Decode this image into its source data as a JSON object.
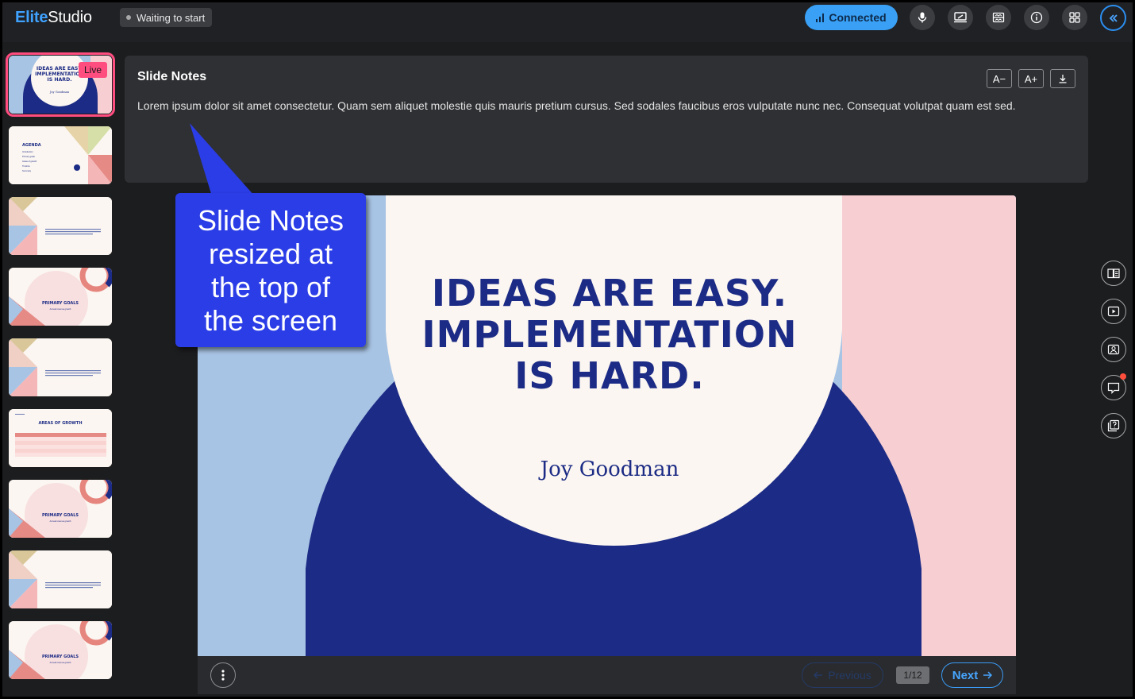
{
  "app": {
    "logo_brand": "Elite",
    "logo_rest": "Studio",
    "status": "Waiting to start",
    "connected_label": "Connected"
  },
  "top_icons": [
    "microphone-icon",
    "screen-share-icon",
    "layout-icon",
    "info-icon",
    "apps-grid-icon"
  ],
  "slides": {
    "live_label": "Live",
    "thumbnails": [
      {
        "title": "IDEAS ARE EASY. IMPLEMENTATION IS HARD.",
        "subtitle": "Joy Goodman"
      },
      {
        "title": "AGENDA",
        "items": [
          "Introduction",
          "Primary goals",
          "Areas of growth",
          "Timeline",
          "Summary"
        ]
      },
      {
        "title": ""
      },
      {
        "title": "PRIMARY GOALS",
        "subtitle": "Annual revenue growth"
      },
      {
        "title": ""
      },
      {
        "title": "AREAS OF GROWTH"
      },
      {
        "title": "PRIMARY GOALS",
        "subtitle": "Annual revenue growth"
      },
      {
        "title": ""
      },
      {
        "title": "PRIMARY GOALS",
        "subtitle": "Annual revenue growth"
      }
    ]
  },
  "notes": {
    "title": "Slide Notes",
    "text": "Lorem ipsum dolor sit amet consectetur. Quam sem aliquet molestie quis mauris pretium cursus. Sed sodales faucibus eros vulputate nunc nec. Consequat volutpat quam est sed.",
    "decrease_label": "A−",
    "increase_label": "A+"
  },
  "slide": {
    "title_line1": "IDEAS ARE EASY.",
    "title_line2": "IMPLEMENTATION",
    "title_line3": "IS HARD.",
    "author": "Joy Goodman"
  },
  "footer": {
    "previous_label": "Previous",
    "next_label": "Next",
    "page": "1/12"
  },
  "callout": {
    "line1": "Slide Notes",
    "line2": "resized at",
    "line3": "the top of",
    "line4": "the screen"
  },
  "colors": {
    "accent": "#39a0f5",
    "live": "#ff4d80",
    "slide_navy": "#1c2b85",
    "slide_blue": "#a8c4e4",
    "slide_pink": "#f7cfd2",
    "slide_cream": "#fbf6f1",
    "callout": "#2b3de6"
  }
}
